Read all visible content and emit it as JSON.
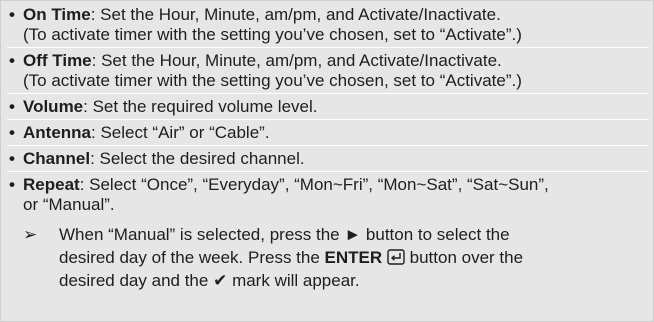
{
  "bullet_glyph": "•",
  "items": [
    {
      "term": "On Time",
      "text1": ": Set the Hour, Minute, am/pm, and Activate/Inactivate.",
      "text2": "(To activate timer with the setting you’ve chosen, set to “Activate”.)"
    },
    {
      "term": "Off Time",
      "text1": ": Set the Hour, Minute, am/pm, and Activate/Inactivate.",
      "text2": "(To activate timer with the setting you’ve chosen, set to “Activate”.)"
    },
    {
      "term": "Volume",
      "text1": ": Set the required volume level."
    },
    {
      "term": "Antenna",
      "text1": ": Select “Air” or “Cable”."
    },
    {
      "term": "Channel",
      "text1": ": Select the desired channel."
    },
    {
      "term": "Repeat",
      "text1": ": Select “Once”, “Everyday”, “Mon~Fri”, “Mon~Sat”, “Sat~Sun”,",
      "text2": "or “Manual”."
    }
  ],
  "note": {
    "arrow_glyph": "➢",
    "line1_before": "When “Manual” is selected, press the",
    "line1_play_glyph": "►",
    "line1_after": "button to select the",
    "line2_before": "desired day of the week. Press the",
    "line2_enter": "ENTER",
    "line2_after": "button over the",
    "line3_before": "desired day and the",
    "line3_check_glyph": "✔",
    "line3_after": "mark will appear."
  },
  "icons": [
    "enter-icon",
    "play-arrow-icon",
    "check-mark-icon",
    "note-arrow-icon"
  ]
}
